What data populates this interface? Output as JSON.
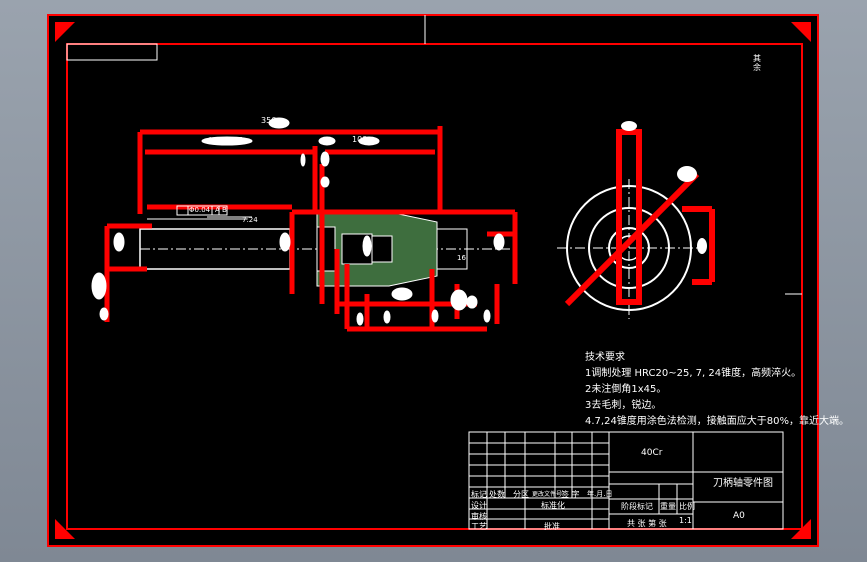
{
  "colors": {
    "background_outer": "#8f98a4",
    "sheet": "#000000",
    "border": "#ff0000",
    "lines": "#ffffff",
    "hatch": "#4a7a4a"
  },
  "header": {
    "roughness_mark": "其 余"
  },
  "dims": {
    "overall_length": "356",
    "taper_dim": "Φ95±0.5",
    "mid_dim": "100",
    "tol": "Φ0.04",
    "datum": "A B",
    "taper": "7:24",
    "right_dim": "16"
  },
  "notes": {
    "title": "技术要求",
    "items": [
      "1调制处理 HRC20~25, 7, 24锥度，高频淬火。",
      "2未注倒角1x45。",
      "3去毛刺，锐边。",
      "4.7,24锥度用涂色法检测，接触面应大于80%，靠近大端。"
    ]
  },
  "title_block": {
    "material": "40Cr",
    "part_name": "刀柄轴零件图",
    "sheet_size": "A0",
    "row_mark": "标记",
    "row_count": "处数",
    "row_zone": "分区",
    "row_doc": "更改文件号",
    "row_sign": "签 字",
    "row_date": "年.月.日",
    "designer": "设计",
    "standard": "标准化",
    "stage": "阶段标记",
    "weight": "重量",
    "scale": "比例",
    "scale_val": "1:1",
    "checker": "审核",
    "process": "工艺",
    "approve": "批准",
    "sheets": "共 张 第 张"
  }
}
